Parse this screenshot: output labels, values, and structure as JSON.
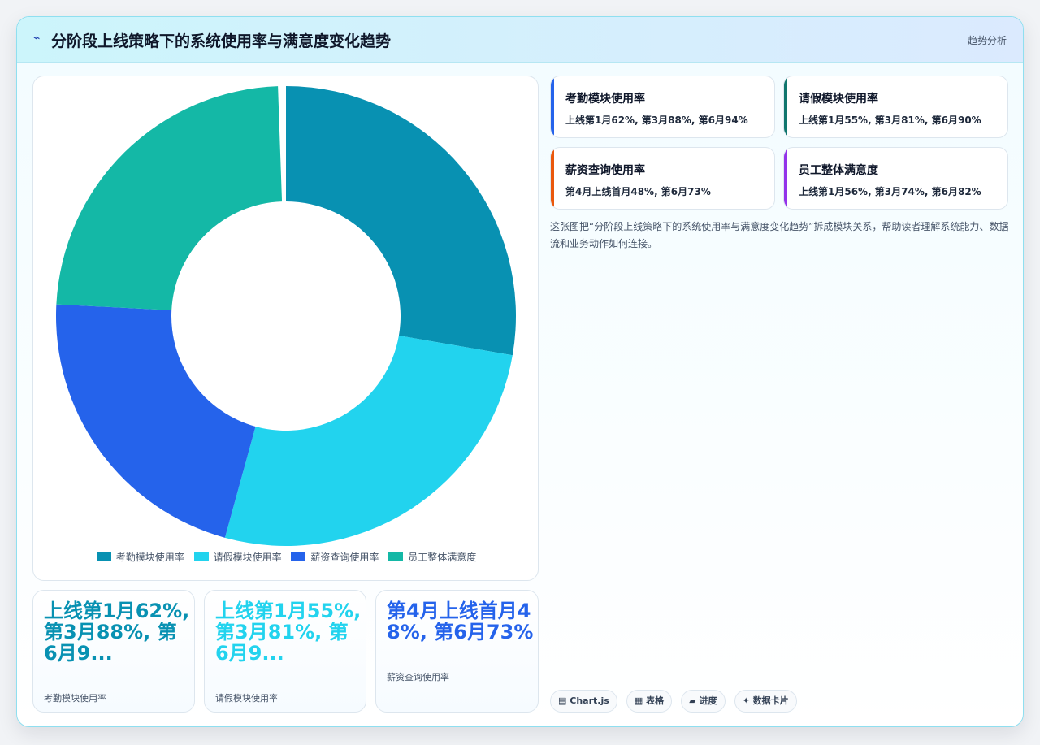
{
  "header": {
    "icon": "⌁",
    "title": "分阶段上线策略下的系统使用率与满意度变化趋势",
    "link": "趋势分析"
  },
  "chart_data": {
    "type": "doughnut",
    "categories": [
      "考勤模块使用率",
      "请假模块使用率",
      "薪资查询使用率",
      "员工整体满意度"
    ],
    "values": [
      94,
      90,
      73,
      82
    ],
    "colors": [
      "#0891b2",
      "#22d3ee",
      "#2563eb",
      "#14b8a6"
    ],
    "legend_position": "bottom"
  },
  "stats": [
    {
      "value": "上线第1月62%, 第3月88%, 第6月9...",
      "label": "考勤模块使用率",
      "color": "#0891b2"
    },
    {
      "value": "上线第1月55%, 第3月81%, 第6月9...",
      "label": "请假模块使用率",
      "color": "#22d3ee"
    },
    {
      "value": "第4月上线首月48%, 第6月73%",
      "label": "薪资查询使用率",
      "color": "#2563eb"
    }
  ],
  "info_cards": [
    {
      "title": "考勤模块使用率",
      "desc": "上线第1月62%, 第3月88%, 第6月94%",
      "color": "#2563eb"
    },
    {
      "title": "请假模块使用率",
      "desc": "上线第1月55%, 第3月81%, 第6月90%",
      "color": "#0f766e"
    },
    {
      "title": "薪资查询使用率",
      "desc": "第4月上线首月48%, 第6月73%",
      "color": "#ea580c"
    },
    {
      "title": "员工整体满意度",
      "desc": "上线第1月56%, 第3月74%, 第6月82%",
      "color": "#9333ea"
    }
  ],
  "caption": "这张图把“分阶段上线策略下的系统使用率与满意度变化趋势”拆成模块关系，帮助读者理解系统能力、数据流和业务动作如何连接。",
  "tags": [
    {
      "icon": "▤",
      "label": "Chart.js"
    },
    {
      "icon": "▦",
      "label": "表格"
    },
    {
      "icon": "▰",
      "label": "进度"
    },
    {
      "icon": "✦",
      "label": "数据卡片"
    }
  ]
}
